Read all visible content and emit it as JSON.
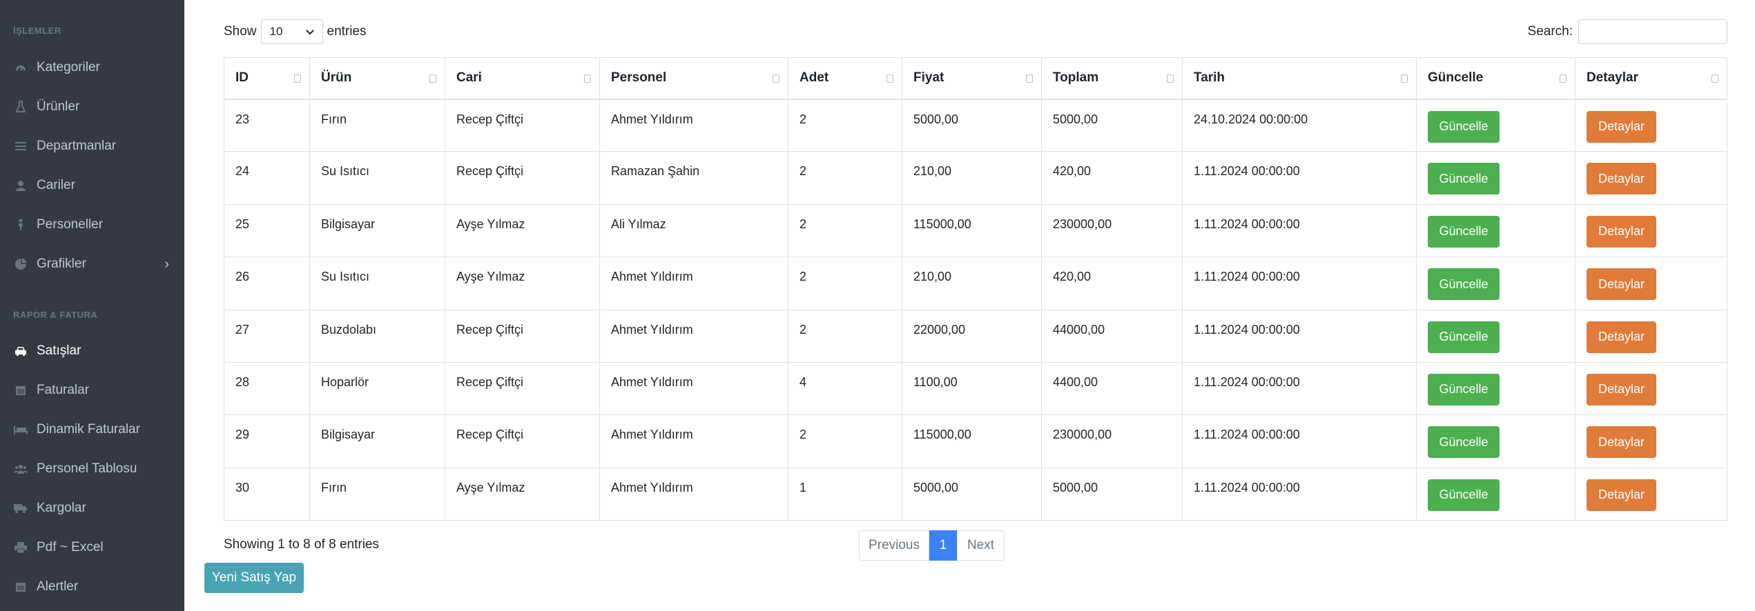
{
  "sidebar": {
    "section1": "İŞLEMLER",
    "section2": "RAPOR & FATURA",
    "items": [
      {
        "label": "Kategoriler",
        "icon": "dashboard-icon"
      },
      {
        "label": "Ürünler",
        "icon": "flask-icon"
      },
      {
        "label": "Departmanlar",
        "icon": "list-icon"
      },
      {
        "label": "Cariler",
        "icon": "user-icon"
      },
      {
        "label": "Personeller",
        "icon": "person-icon"
      },
      {
        "label": "Grafikler",
        "icon": "pie-chart-icon"
      },
      {
        "label": "Satışlar",
        "icon": "car-icon"
      },
      {
        "label": "Faturalar",
        "icon": "calendar-icon"
      },
      {
        "label": "Dinamik Faturalar",
        "icon": "bed-icon"
      },
      {
        "label": "Personel Tablosu",
        "icon": "users-icon"
      },
      {
        "label": "Kargolar",
        "icon": "truck-icon"
      },
      {
        "label": "Pdf ~ Excel",
        "icon": "print-icon"
      },
      {
        "label": "Alertler",
        "icon": "calendar-icon"
      }
    ]
  },
  "controls": {
    "show_label": "Show",
    "show_value": "10",
    "entries_label": "entries",
    "search_label": "Search:",
    "search_value": ""
  },
  "table": {
    "columns": [
      "ID",
      "Ürün",
      "Cari",
      "Personel",
      "Adet",
      "Fiyat",
      "Toplam",
      "Tarih",
      "Güncelle",
      "Detaylar"
    ],
    "rows": [
      {
        "id": "23",
        "urun": "Fırın",
        "cari": "Recep Çiftçi",
        "personel": "Ahmet Yıldırım",
        "adet": "2",
        "fiyat": "5000,00",
        "toplam": "5000,00",
        "tarih": "24.10.2024 00:00:00"
      },
      {
        "id": "24",
        "urun": "Su Isıtıcı",
        "cari": "Recep Çiftçi",
        "personel": "Ramazan Şahin",
        "adet": "2",
        "fiyat": "210,00",
        "toplam": "420,00",
        "tarih": "1.11.2024 00:00:00"
      },
      {
        "id": "25",
        "urun": "Bilgisayar",
        "cari": "Ayşe Yılmaz",
        "personel": "Ali Yılmaz",
        "adet": "2",
        "fiyat": "115000,00",
        "toplam": "230000,00",
        "tarih": "1.11.2024 00:00:00"
      },
      {
        "id": "26",
        "urun": "Su Isıtıcı",
        "cari": "Ayşe Yılmaz",
        "personel": "Ahmet Yıldırım",
        "adet": "2",
        "fiyat": "210,00",
        "toplam": "420,00",
        "tarih": "1.11.2024 00:00:00"
      },
      {
        "id": "27",
        "urun": "Buzdolabı",
        "cari": "Recep Çiftçi",
        "personel": "Ahmet Yıldırım",
        "adet": "2",
        "fiyat": "22000,00",
        "toplam": "44000,00",
        "tarih": "1.11.2024 00:00:00"
      },
      {
        "id": "28",
        "urun": "Hoparlör",
        "cari": "Recep Çiftçi",
        "personel": "Ahmet Yıldırım",
        "adet": "4",
        "fiyat": "1100,00",
        "toplam": "4400,00",
        "tarih": "1.11.2024 00:00:00"
      },
      {
        "id": "29",
        "urun": "Bilgisayar",
        "cari": "Recep Çiftçi",
        "personel": "Ahmet Yıldırım",
        "adet": "2",
        "fiyat": "115000,00",
        "toplam": "230000,00",
        "tarih": "1.11.2024 00:00:00"
      },
      {
        "id": "30",
        "urun": "Fırın",
        "cari": "Ayşe Yılmaz",
        "personel": "Ahmet Yıldırım",
        "adet": "1",
        "fiyat": "5000,00",
        "toplam": "5000,00",
        "tarih": "1.11.2024 00:00:00"
      }
    ],
    "update_label": "Güncelle",
    "details_label": "Detaylar"
  },
  "footer": {
    "info": "Showing 1 to 8 of 8 entries",
    "prev": "Previous",
    "page": "1",
    "next": "Next",
    "new_sale": "Yeni Satış Yap"
  },
  "colors": {
    "sidebar_bg": "#343a40",
    "update_button": "#4caf50",
    "details_button": "#e07b39",
    "active_page": "#3b82f6",
    "new_sale_button": "#4aa3b5"
  }
}
